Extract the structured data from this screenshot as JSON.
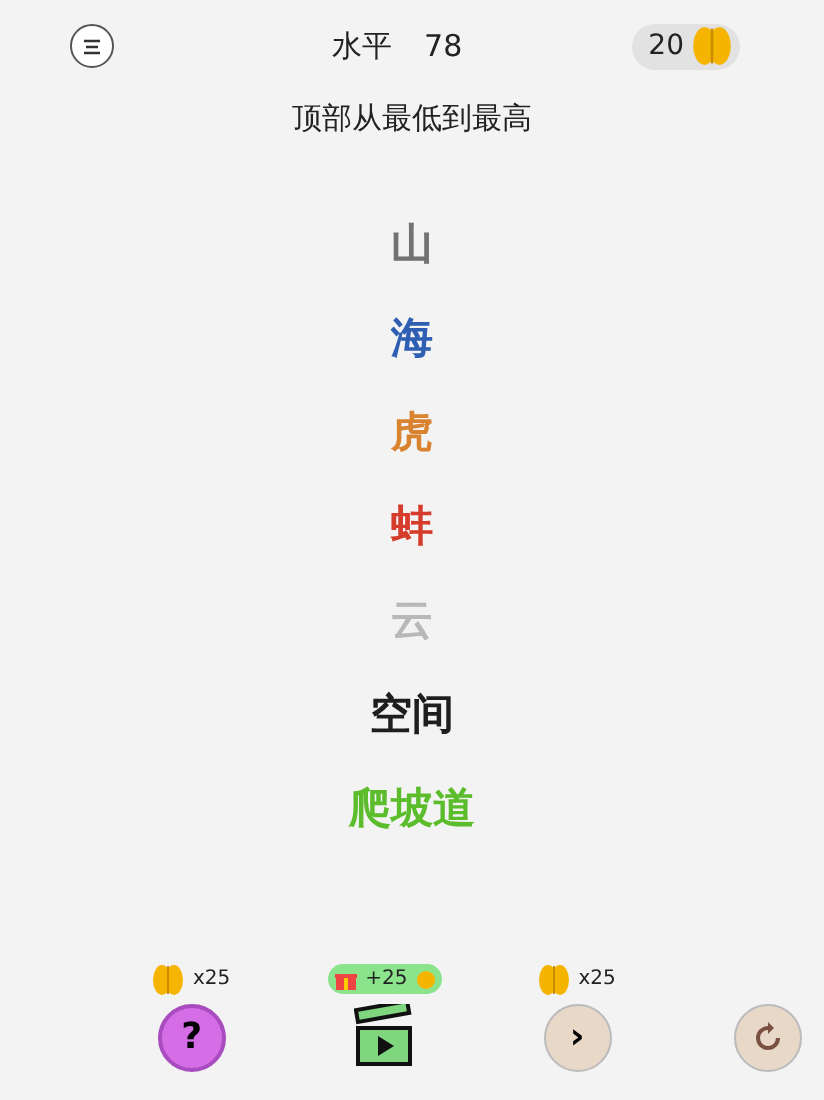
{
  "header": {
    "level_label": "水平",
    "level": "78",
    "coins": "20"
  },
  "instruction": "顶部从最低到最高",
  "words": [
    {
      "text": "山",
      "color": "#727272"
    },
    {
      "text": "海",
      "color": "#2f5fb3"
    },
    {
      "text": "虎",
      "color": "#d98330"
    },
    {
      "text": "蚌",
      "color": "#d63c2b"
    },
    {
      "text": "云",
      "color": "#b8b8b8"
    },
    {
      "text": "空间",
      "color": "#1e1e1e"
    },
    {
      "text": "爬坡道",
      "color": "#5cbd2c"
    }
  ],
  "powerups": [
    {
      "kind": "hint",
      "cost": "x25",
      "symbol": "?"
    },
    {
      "kind": "video",
      "cost": "+25"
    },
    {
      "kind": "skip",
      "cost": "x25",
      "symbol": "›"
    },
    {
      "kind": "restart"
    }
  ]
}
